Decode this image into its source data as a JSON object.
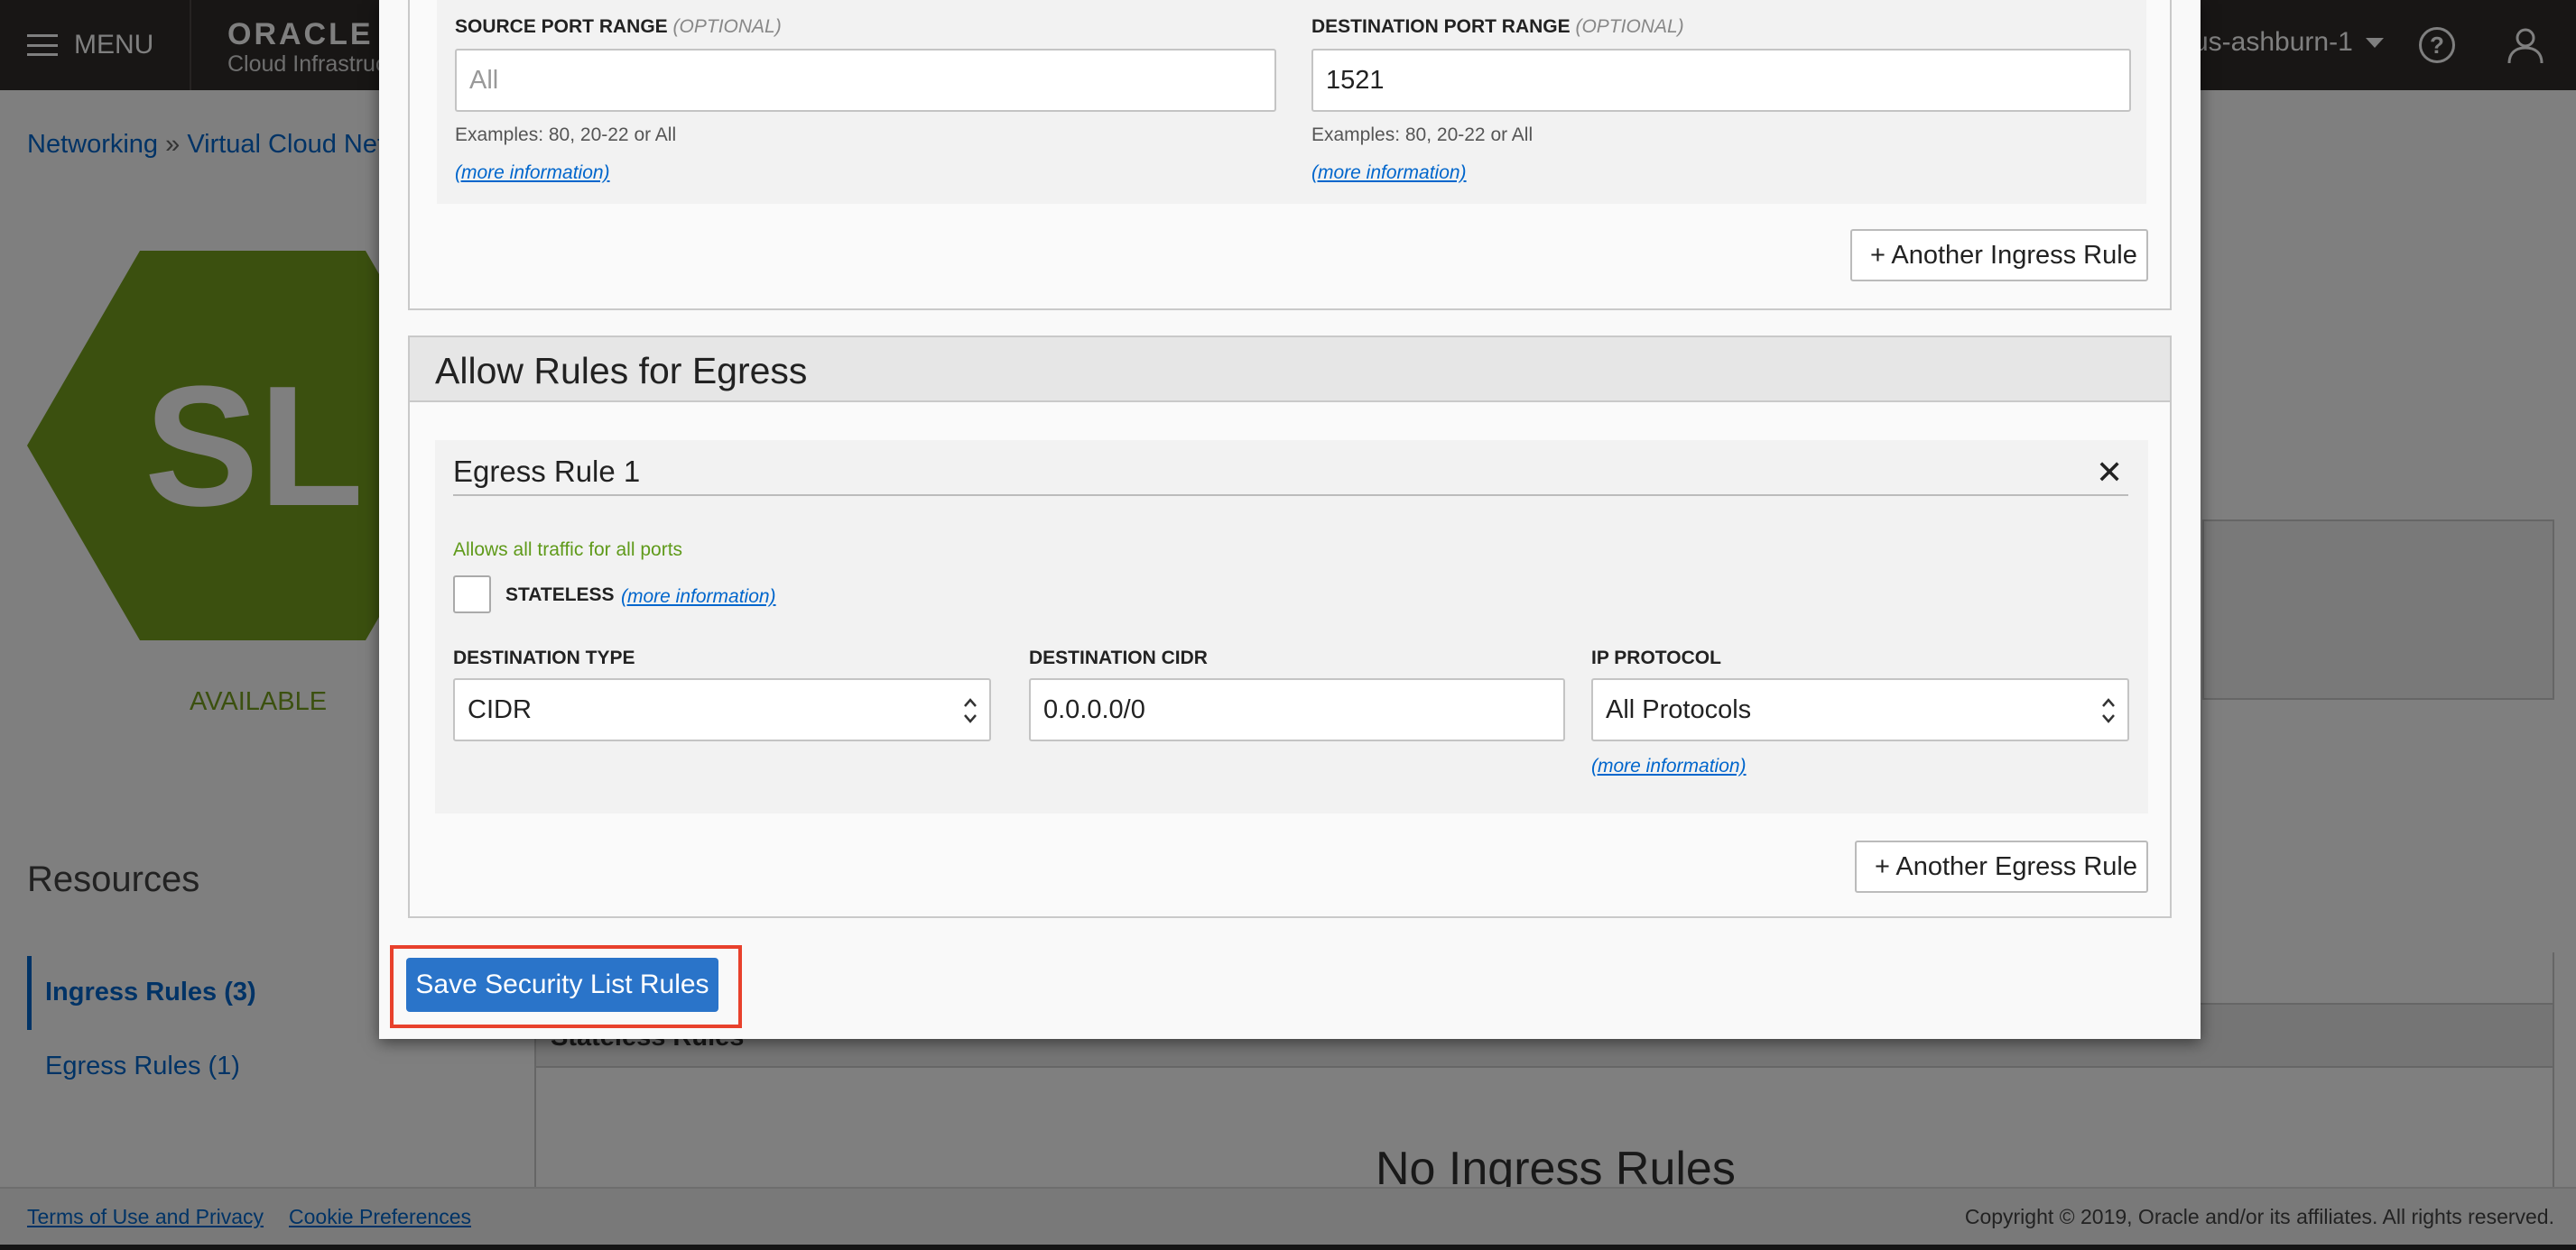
{
  "header": {
    "menu_label": "MENU",
    "logo_oracle": "ORACLE",
    "logo_sub": "Cloud Infrastructure",
    "region": "us-ashburn-1"
  },
  "breadcrumb": {
    "items": [
      "Networking",
      "Virtual Cloud Networks"
    ],
    "separator": "»"
  },
  "resource": {
    "initials": "SL",
    "status": "AVAILABLE",
    "status_color": "#77a11f",
    "icon_color": "#77a11f"
  },
  "sidebar": {
    "title": "Resources",
    "items": [
      {
        "label": "Ingress Rules (3)",
        "active": true
      },
      {
        "label": "Egress Rules (1)",
        "active": false
      }
    ]
  },
  "table": {
    "header": "Stateless Rules",
    "empty_text": "No Ingress Rules"
  },
  "footer": {
    "terms": "Terms of Use and Privacy",
    "cookies": "Cookie Preferences",
    "copyright": "Copyright © 2019, Oracle and/or its affiliates. All rights reserved."
  },
  "dialog": {
    "ingress": {
      "source_port_label": "SOURCE PORT RANGE",
      "source_port_optional": "(OPTIONAL)",
      "source_port_placeholder": "All",
      "source_port_value": "",
      "source_port_hint": "Examples: 80, 20-22 or All",
      "dest_port_label": "DESTINATION PORT RANGE",
      "dest_port_optional": "(OPTIONAL)",
      "dest_port_value": "1521",
      "dest_port_hint": "Examples: 80, 20-22 or All",
      "more_info": "(more information)",
      "another_button": "+ Another Ingress Rule"
    },
    "egress": {
      "section_title": "Allow Rules for Egress",
      "rule_title": "Egress Rule 1",
      "note": "Allows all traffic for all ports",
      "stateless_label": "STATELESS",
      "stateless_checked": false,
      "more_info": "(more information)",
      "dest_type_label": "DESTINATION TYPE",
      "dest_type_value": "CIDR",
      "dest_cidr_label": "DESTINATION CIDR",
      "dest_cidr_value": "0.0.0.0/0",
      "ip_protocol_label": "IP PROTOCOL",
      "ip_protocol_value": "All Protocols",
      "another_button": "+ Another Egress Rule"
    },
    "save_button": "Save Security List Rules",
    "accent_color": "#2a74c9",
    "highlight_color": "#e8412c"
  }
}
